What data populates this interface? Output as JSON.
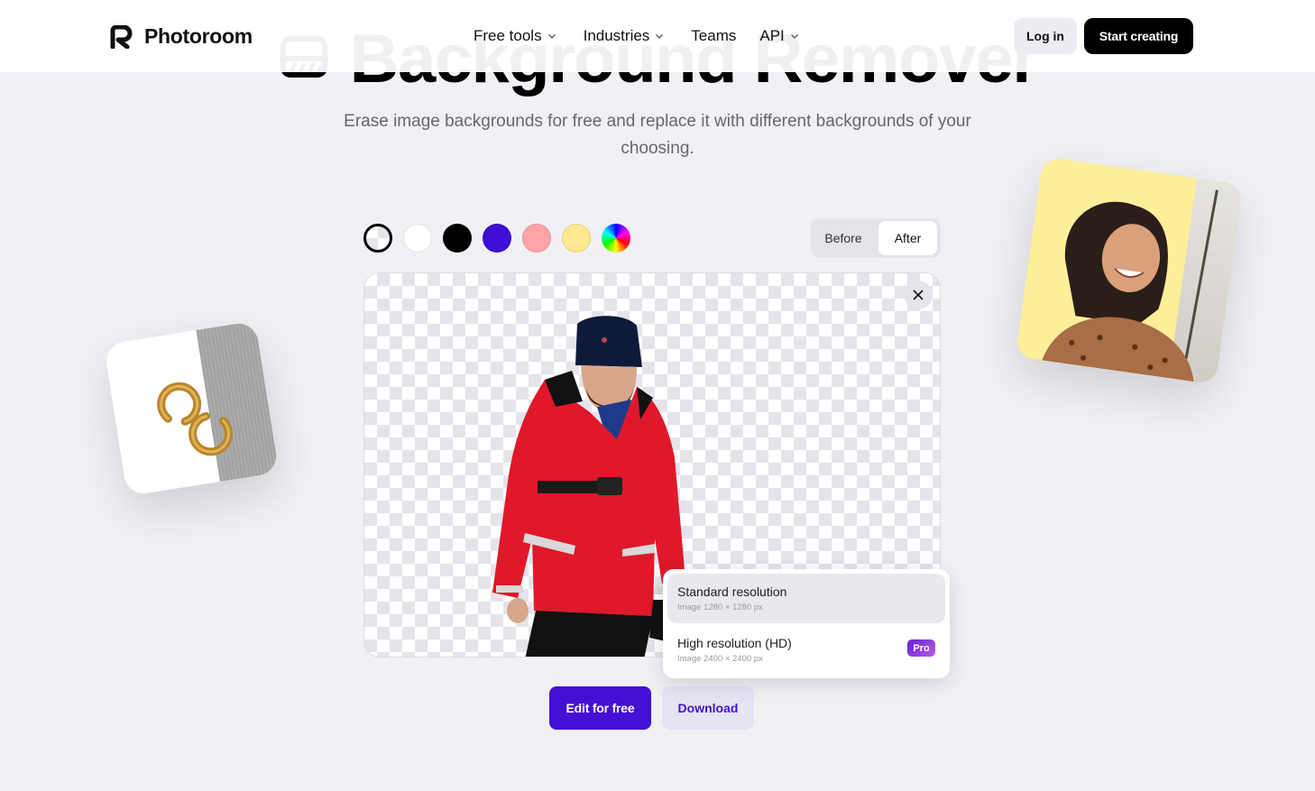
{
  "header": {
    "brand": "Photoroom",
    "nav": [
      {
        "label": "Free tools",
        "has_dropdown": true
      },
      {
        "label": "Industries",
        "has_dropdown": true
      },
      {
        "label": "Teams",
        "has_dropdown": false
      },
      {
        "label": "API",
        "has_dropdown": true
      }
    ],
    "login_label": "Log in",
    "start_label": "Start creating"
  },
  "hero": {
    "title": "Background Remover",
    "icon": "background-remover-icon",
    "subtitle": "Erase image backgrounds for free and replace it with different backgrounds of your choosing."
  },
  "editor": {
    "swatches": [
      {
        "name": "transparent",
        "color": "transparent",
        "selected": true
      },
      {
        "name": "white",
        "color": "#ffffff"
      },
      {
        "name": "black",
        "color": "#000000"
      },
      {
        "name": "purple",
        "color": "#3f10d4"
      },
      {
        "name": "pink",
        "color": "#ffa3a6"
      },
      {
        "name": "yellow",
        "color": "#ffe88f"
      },
      {
        "name": "custom",
        "color": "rainbow"
      }
    ],
    "toggle": {
      "before": "Before",
      "after": "After",
      "active": "After"
    },
    "close_icon": "close-icon",
    "resolution_options": [
      {
        "title": "Standard resolution",
        "subtitle": "Image 1280 × 1280 px",
        "selected": true
      },
      {
        "title": "High resolution (HD)",
        "subtitle": "Image 2400 × 2400 px",
        "badge": "Pro"
      }
    ],
    "edit_label": "Edit for free",
    "download_label": "Download"
  },
  "colors": {
    "accent": "#4310d6",
    "background": "#f1f1f5",
    "download_bg": "#e6e3f3"
  }
}
